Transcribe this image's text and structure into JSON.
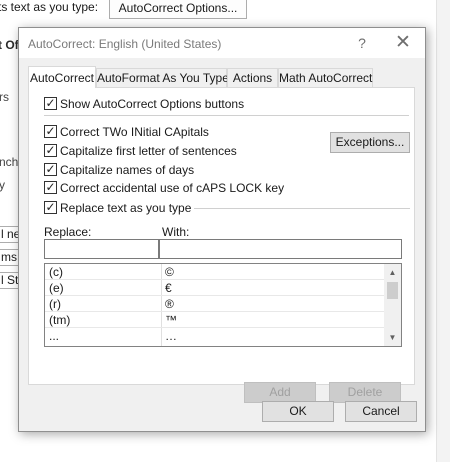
{
  "background": {
    "top_text": "ts text as you type:",
    "top_button": "AutoCorrect Options...",
    "bold_label": "t Of",
    "side_text_1": "rs",
    "side_text_2": "nch",
    "side_text_3": "y",
    "cells": [
      "l ne",
      "ms c",
      "l St"
    ]
  },
  "dialog": {
    "title": "AutoCorrect: English (United States)",
    "help_icon": "?",
    "close_icon": "✕",
    "tabs": [
      {
        "label": "AutoCorrect",
        "active": true
      },
      {
        "label": "AutoFormat As You Type",
        "active": false
      },
      {
        "label": "Actions",
        "active": false
      },
      {
        "label": "Math AutoCorrect",
        "active": false
      }
    ],
    "show_options_label": "Show AutoCorrect Options buttons",
    "options": [
      {
        "label": "Correct TWo INitial CApitals",
        "checked": true
      },
      {
        "label": "Capitalize first letter of sentences",
        "checked": true
      },
      {
        "label": "Capitalize names of days",
        "checked": true
      },
      {
        "label": "Correct accidental use of cAPS LOCK key",
        "checked": true
      }
    ],
    "exceptions_label": "Exceptions...",
    "replace_as_type_label": "Replace text as you type",
    "replace_label": "Replace:",
    "with_label": "With:",
    "replace_value": "",
    "with_value": "",
    "entries": [
      {
        "replace": "(c)",
        "with": "©"
      },
      {
        "replace": "(e)",
        "with": "€"
      },
      {
        "replace": "(r)",
        "with": "®"
      },
      {
        "replace": "(tm)",
        "with": "™"
      },
      {
        "replace": "...",
        "with": "…"
      }
    ],
    "add_label": "Add",
    "delete_label": "Delete",
    "ok_label": "OK",
    "cancel_label": "Cancel",
    "check_glyph": "✓",
    "scroll_up_glyph": "▲",
    "scroll_down_glyph": "▼"
  }
}
